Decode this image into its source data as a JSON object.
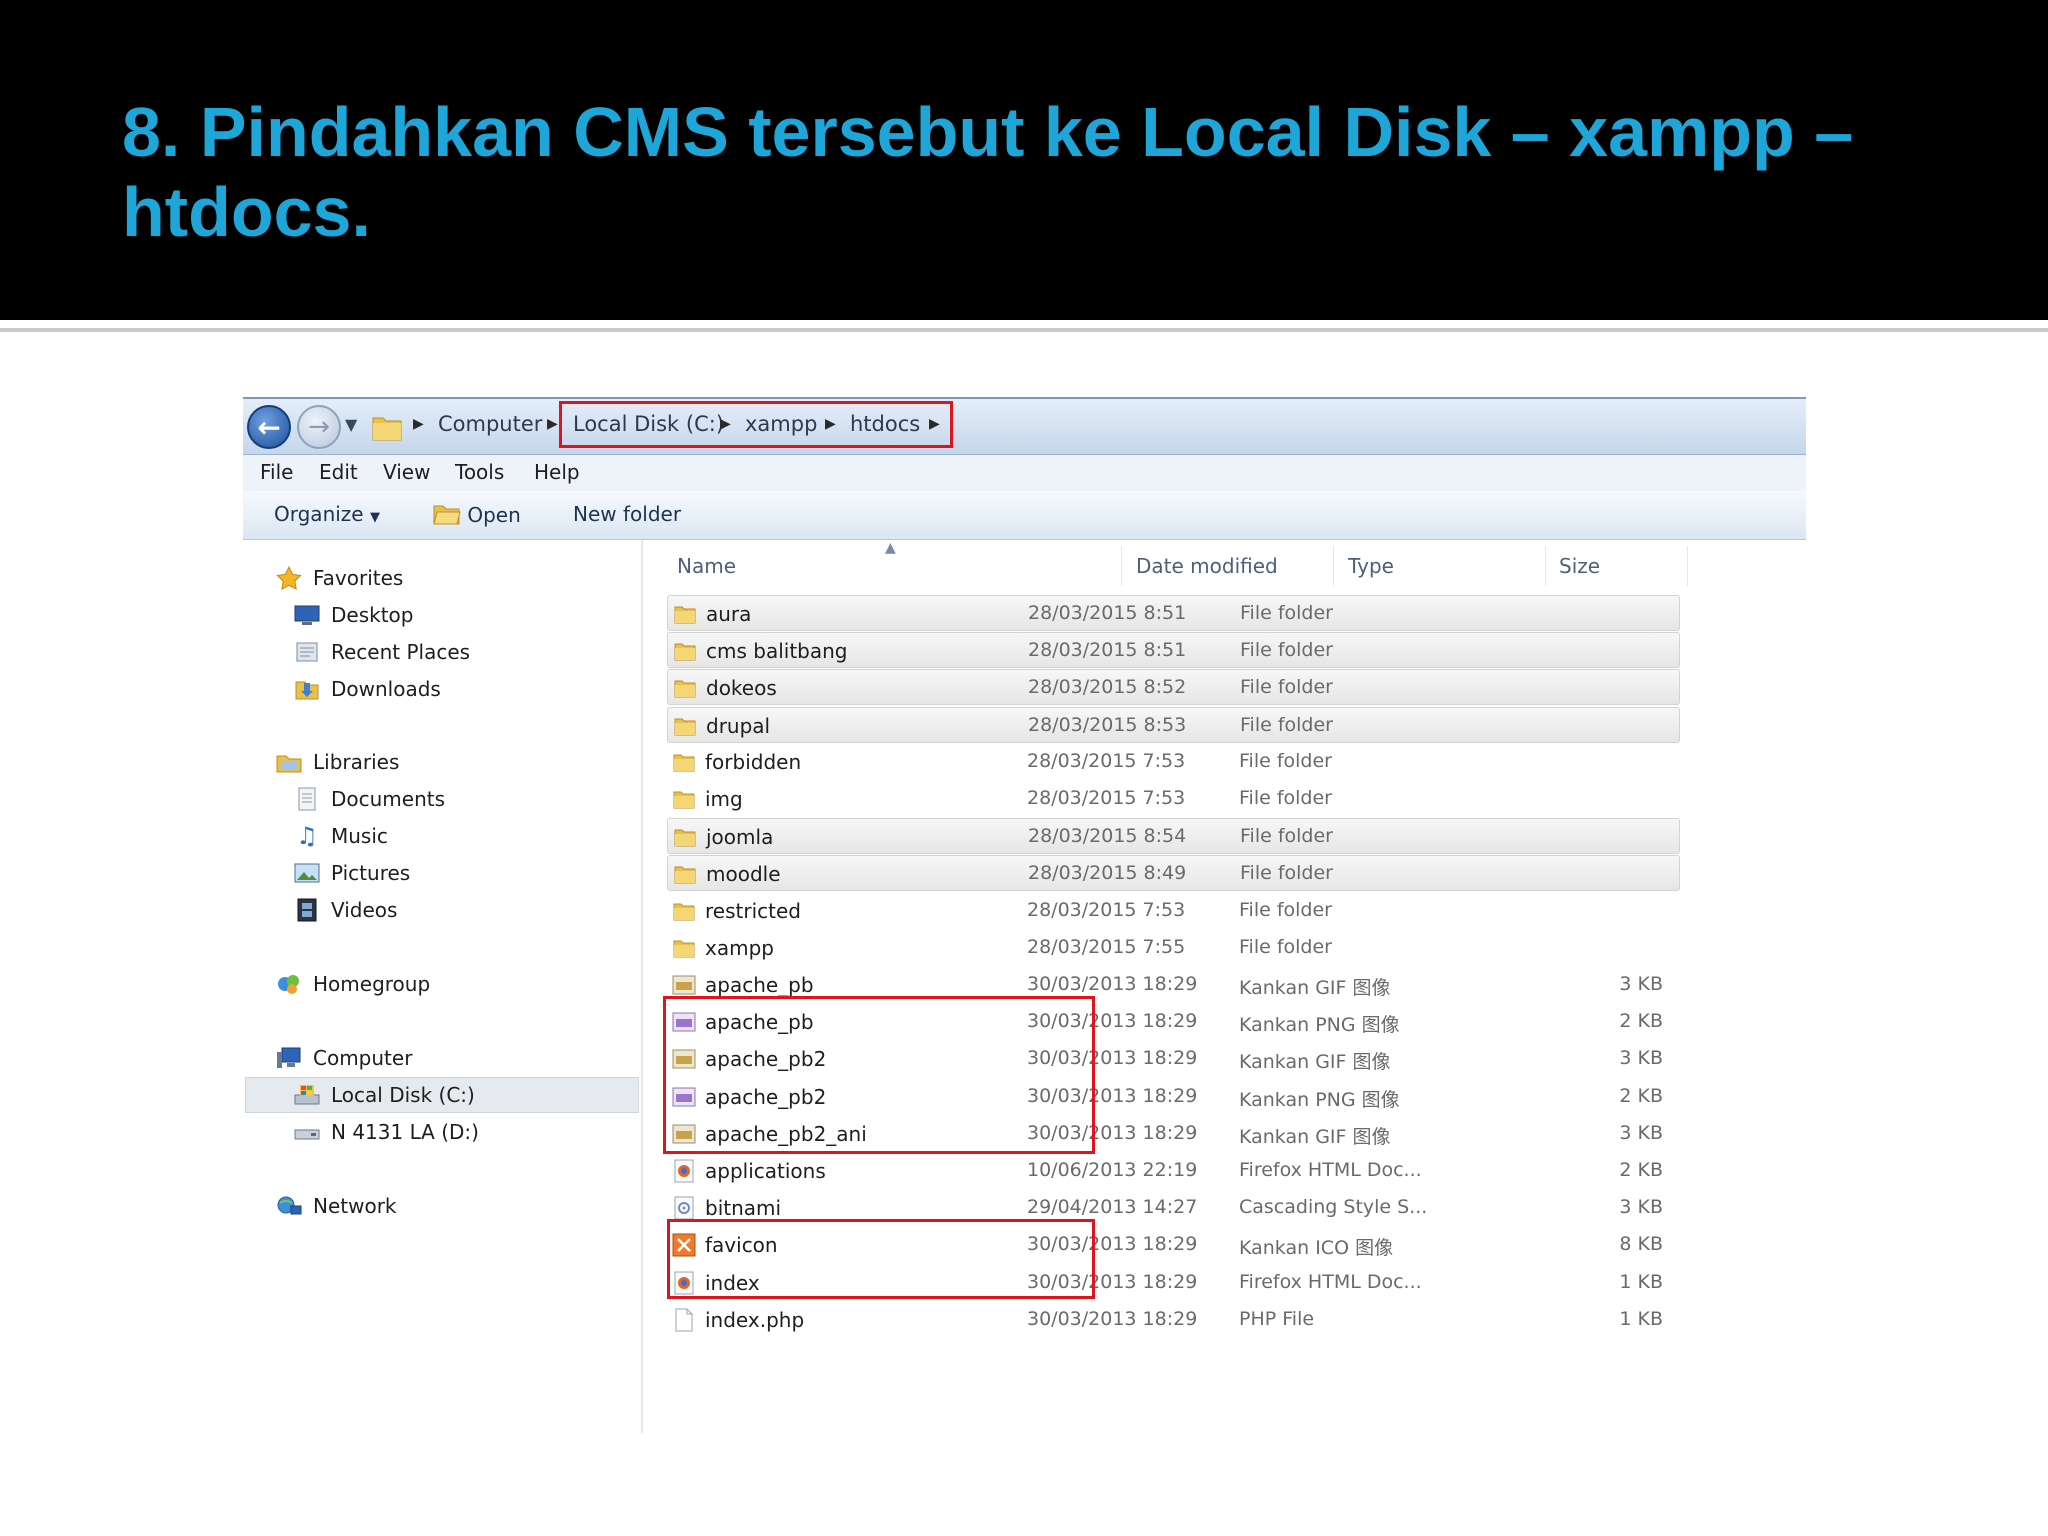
{
  "slide": {
    "title": "8. Pindahkan CMS tersebut ke Local Disk – xampp – htdocs."
  },
  "address_bar": {
    "breadcrumb": [
      "Computer",
      "Local Disk (C:)",
      "xampp",
      "htdocs"
    ],
    "icons": [
      "back-arrow-icon",
      "forward-arrow-icon",
      "chevron-down-icon",
      "folder-icon",
      "chevron-right-icon"
    ]
  },
  "menu_bar": [
    "File",
    "Edit",
    "View",
    "Tools",
    "Help"
  ],
  "command_bar": {
    "organize": "Organize",
    "open": "Open",
    "new_folder": "New folder"
  },
  "nav_pane": {
    "favorites": {
      "label": "Favorites",
      "items": [
        "Desktop",
        "Recent Places",
        "Downloads"
      ]
    },
    "libraries": {
      "label": "Libraries",
      "items": [
        "Documents",
        "Music",
        "Pictures",
        "Videos"
      ]
    },
    "homegroup": {
      "label": "Homegroup"
    },
    "computer": {
      "label": "Computer",
      "items": [
        "Local Disk (C:)",
        "N 4131 LA (D:)"
      ]
    },
    "network": {
      "label": "Network"
    },
    "selected": "Local Disk (C:)"
  },
  "columns": {
    "name": "Name",
    "date": "Date modified",
    "type": "Type",
    "size": "Size"
  },
  "files": [
    {
      "name": "aura",
      "date": "28/03/2015 8:51",
      "type": "File folder",
      "size": "",
      "icon": "folder-icon",
      "highlight": true
    },
    {
      "name": "cms balitbang",
      "date": "28/03/2015 8:51",
      "type": "File folder",
      "size": "",
      "icon": "folder-icon",
      "highlight": true
    },
    {
      "name": "dokeos",
      "date": "28/03/2015 8:52",
      "type": "File folder",
      "size": "",
      "icon": "folder-icon",
      "highlight": true
    },
    {
      "name": "drupal",
      "date": "28/03/2015 8:53",
      "type": "File folder",
      "size": "",
      "icon": "folder-icon",
      "highlight": true
    },
    {
      "name": "forbidden",
      "date": "28/03/2015 7:53",
      "type": "File folder",
      "size": "",
      "icon": "folder-icon",
      "highlight": false
    },
    {
      "name": "img",
      "date": "28/03/2015 7:53",
      "type": "File folder",
      "size": "",
      "icon": "folder-icon",
      "highlight": false
    },
    {
      "name": "joomla",
      "date": "28/03/2015 8:54",
      "type": "File folder",
      "size": "",
      "icon": "folder-icon",
      "highlight": true
    },
    {
      "name": "moodle",
      "date": "28/03/2015 8:49",
      "type": "File folder",
      "size": "",
      "icon": "folder-icon",
      "highlight": true
    },
    {
      "name": "restricted",
      "date": "28/03/2015 7:53",
      "type": "File folder",
      "size": "",
      "icon": "folder-icon",
      "highlight": false
    },
    {
      "name": "xampp",
      "date": "28/03/2015 7:55",
      "type": "File folder",
      "size": "",
      "icon": "folder-icon",
      "highlight": false
    },
    {
      "name": "apache_pb",
      "date": "30/03/2013 18:29",
      "type": "Kankan GIF 图像",
      "size": "3 KB",
      "icon": "gif-image-icon",
      "highlight": false
    },
    {
      "name": "apache_pb",
      "date": "30/03/2013 18:29",
      "type": "Kankan PNG 图像",
      "size": "2 KB",
      "icon": "png-image-icon",
      "highlight": false
    },
    {
      "name": "apache_pb2",
      "date": "30/03/2013 18:29",
      "type": "Kankan GIF 图像",
      "size": "3 KB",
      "icon": "gif-image-icon",
      "highlight": false
    },
    {
      "name": "apache_pb2",
      "date": "30/03/2013 18:29",
      "type": "Kankan PNG 图像",
      "size": "2 KB",
      "icon": "png-image-icon",
      "highlight": false
    },
    {
      "name": "apache_pb2_ani",
      "date": "30/03/2013 18:29",
      "type": "Kankan GIF 图像",
      "size": "3 KB",
      "icon": "gif-image-icon",
      "highlight": false
    },
    {
      "name": "applications",
      "date": "10/06/2013 22:19",
      "type": "Firefox HTML Doc...",
      "size": "2 KB",
      "icon": "firefox-document-icon",
      "highlight": false
    },
    {
      "name": "bitnami",
      "date": "29/04/2013 14:27",
      "type": "Cascading Style S...",
      "size": "3 KB",
      "icon": "stylesheet-icon",
      "highlight": false
    },
    {
      "name": "favicon",
      "date": "30/03/2013 18:29",
      "type": "Kankan ICO 图像",
      "size": "8 KB",
      "icon": "ico-image-icon",
      "highlight": false
    },
    {
      "name": "index",
      "date": "30/03/2013 18:29",
      "type": "Firefox HTML Doc...",
      "size": "1 KB",
      "icon": "firefox-document-icon",
      "highlight": false
    },
    {
      "name": "index.php",
      "date": "30/03/2013 18:29",
      "type": "PHP File",
      "size": "1 KB",
      "icon": "blank-file-icon",
      "highlight": false
    }
  ],
  "colors": {
    "title_text": "#1ea6d8",
    "highlight_box": "#e0141e",
    "folder_yellow": "#e9c04b"
  }
}
